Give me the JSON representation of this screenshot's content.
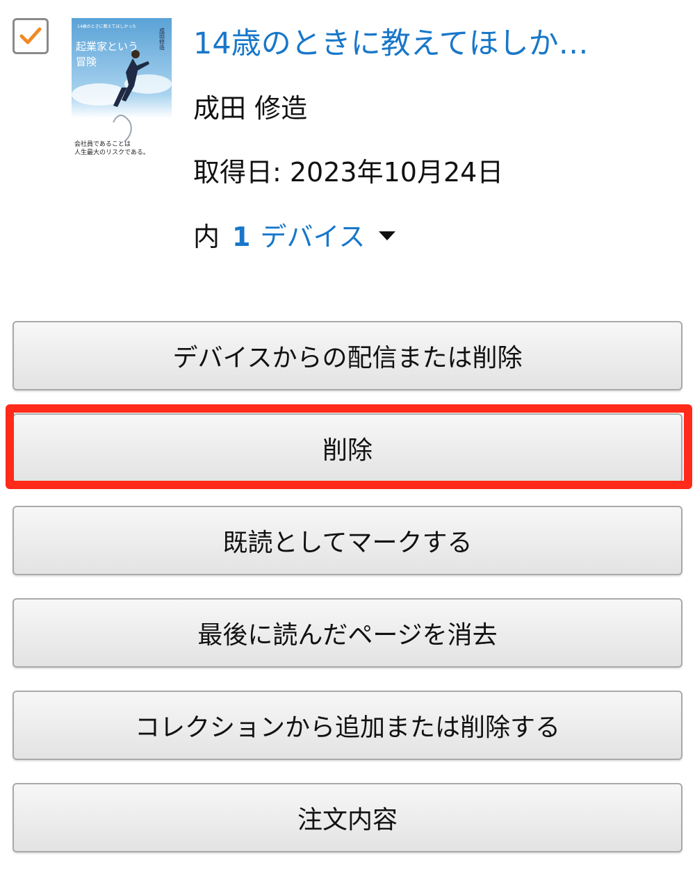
{
  "book": {
    "title": "14歳のときに教えてほしか…",
    "author": "成田 修造",
    "acquired": "取得日: 2023年10月24日",
    "checked": true,
    "cover": {
      "small_text": "14歳のときに教えてほしかった",
      "main_title_line1": "起業家という",
      "main_title_line2": "冒険",
      "author_vertical": "成田修造",
      "tagline_line1": "会社員であることは",
      "tagline_line2": "人生最大のリスクである。",
      "bg_color": "#7fb8e0"
    }
  },
  "devices": {
    "prefix": "内",
    "count": "1",
    "label": "デバイス",
    "icon": "caret-down-icon"
  },
  "actions": [
    {
      "label": "デバイスからの配信または削除"
    },
    {
      "label": "削除"
    },
    {
      "label": "既読としてマークする"
    },
    {
      "label": "最後に読んだページを消去"
    },
    {
      "label": "コレクションから追加または削除する"
    },
    {
      "label": "注文内容"
    }
  ],
  "colors": {
    "link": "#1877c9",
    "checkmark": "#f08a24",
    "highlight": "#ff2a1a"
  }
}
